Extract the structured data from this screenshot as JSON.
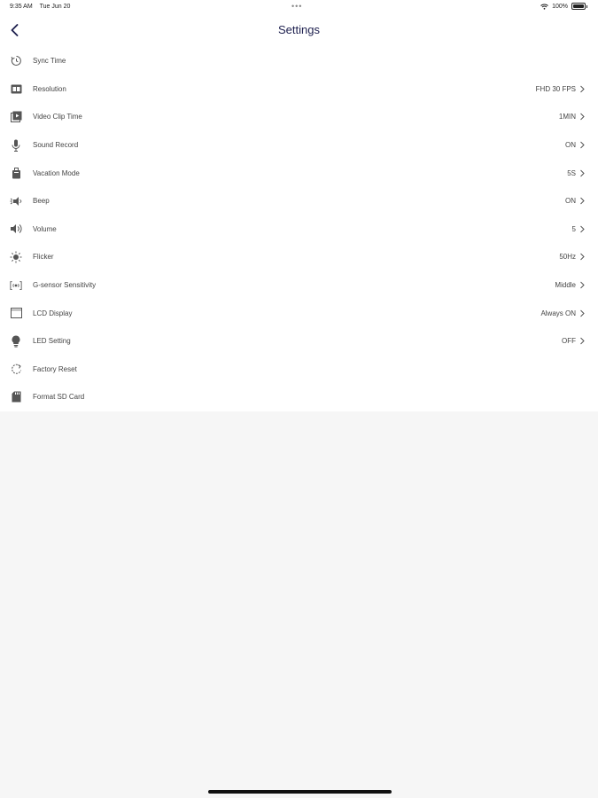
{
  "status": {
    "time": "9:35 AM",
    "date": "Tue Jun 20",
    "dots": "•••",
    "battery": "100%"
  },
  "nav": {
    "title": "Settings"
  },
  "settings": [
    {
      "label": "Sync Time",
      "value": "",
      "icon": "clock-sync-icon"
    },
    {
      "label": "Resolution",
      "value": "FHD 30 FPS",
      "icon": "resolution-icon"
    },
    {
      "label": "Video Clip Time",
      "value": "1MIN",
      "icon": "video-clip-icon"
    },
    {
      "label": "Sound Record",
      "value": "ON",
      "icon": "microphone-icon"
    },
    {
      "label": "Vacation Mode",
      "value": "5S",
      "icon": "suitcase-icon"
    },
    {
      "label": "Beep",
      "value": "ON",
      "icon": "beep-speaker-icon"
    },
    {
      "label": "Volume",
      "value": "5",
      "icon": "volume-icon"
    },
    {
      "label": "Flicker",
      "value": "50Hz",
      "icon": "sun-icon"
    },
    {
      "label": "G-sensor Sensitivity",
      "value": "Middle",
      "icon": "g-sensor-icon"
    },
    {
      "label": "LCD Display",
      "value": "Always ON",
      "icon": "lcd-display-icon"
    },
    {
      "label": "LED Setting",
      "value": "OFF",
      "icon": "led-bulb-icon"
    },
    {
      "label": "Factory Reset",
      "value": "",
      "icon": "reset-icon"
    },
    {
      "label": "Format SD Card",
      "value": "",
      "icon": "sd-card-icon"
    }
  ],
  "colors": {
    "accent": "#1d1f4e",
    "background": "#f6f6f6",
    "list_background": "#ffffff"
  }
}
